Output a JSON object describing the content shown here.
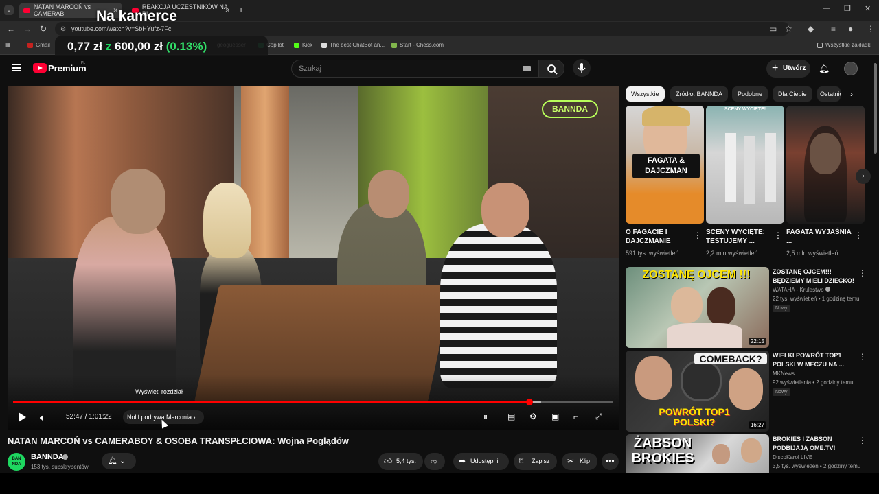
{
  "browser": {
    "tabs": [
      {
        "label": "NATAN MARCOŃ vs CAMERAB"
      },
      {
        "label": "REAKCJA UCZESTNIKÓW NA PI"
      }
    ],
    "url": "youtube.com/watch?v=SbHYufz-7Fc",
    "bookmarks": [
      "Gmail",
      "geoguesser",
      "Copilot",
      "Kick",
      "The best ChatBot an...",
      "Start - Chess.com"
    ],
    "all_bookmarks": "Wszystkie zakładki"
  },
  "stream_overlay": {
    "title": "Na kamerce",
    "price_value": "0,77 zł",
    "price_sep": "z",
    "price_total": "600,00 zł",
    "price_pct": "(0.13%)"
  },
  "header": {
    "logo_text": "Premium",
    "logo_region": "PL",
    "search_placeholder": "Szukaj",
    "create_label": "Utwórz"
  },
  "player": {
    "neon_sign": "BANNDA",
    "chapter_tooltip": "Wyświetl rozdział",
    "time_current": "52:47",
    "time_total": "1:01:22",
    "chapter_label": "Nolif podrywa Marconia",
    "played_fraction": 0.86,
    "loaded_fraction": 0.88
  },
  "video": {
    "title": "NATAN MARCOŃ vs CAMERABOY & OSOBA TRANSPŁCIOWA: Wojna Poglądów",
    "channel": "BANNDA",
    "channel_avatar_text": "BAN NDA",
    "subscribers": "153 tys. subskrybentów",
    "likes": "5,4 tys.",
    "share": "Udostępnij",
    "save": "Zapisz",
    "clip": "Klip"
  },
  "sidebar": {
    "chips": [
      "Wszystkie",
      "Źródło: BANNDA",
      "Podobne",
      "Dla Ciebie",
      "Ostatnio"
    ],
    "shorts": [
      {
        "title": "O FAGACIE I DAJCZMANIE",
        "views": "591 tys. wyświetleń",
        "overlay": "FAGATA & DAJCZMAN"
      },
      {
        "title": "SCENY WYCIĘTE: TESTUJEMY ...",
        "views": "2,2 mln wyświetleń",
        "overlay": "SCENY WYCIĘTE!"
      },
      {
        "title": "FAGATA WYJAŚNIA ...",
        "views": "2,5 mln wyświetleń",
        "overlay": ""
      }
    ],
    "videos": [
      {
        "title": "ZOSTANĘ OJCEM!!! BĘDZIEMY MIELI DZIECKO!",
        "channel": "WATAHA - Krulestwo",
        "meta": "22 tys. wyświetleń • 1 godzinę temu",
        "badge": "Nowy",
        "duration": "22:15",
        "overlay": "ZOSTANĘ OJCEM !!!"
      },
      {
        "title": "WIELKI POWRÓT TOP1 POLSKI W MECZU NA ...",
        "channel": "MKNews",
        "meta": "92 wyświetlenia • 2 godziny temu",
        "badge": "Nowy",
        "duration": "16:27",
        "overlay": "COMEBACK?",
        "overlay2": "POWRÓT TOP1 POLSKI?"
      },
      {
        "title": "BROKIES I ŻABSON PODBIJAJĄ OME.TV!",
        "channel": "DiscoKarol LIVE",
        "meta": "3,5 tys. wyświetleń • 2 godziny temu",
        "badge": "",
        "duration": "",
        "overlay": "ŻABSON BROKIES"
      }
    ]
  }
}
